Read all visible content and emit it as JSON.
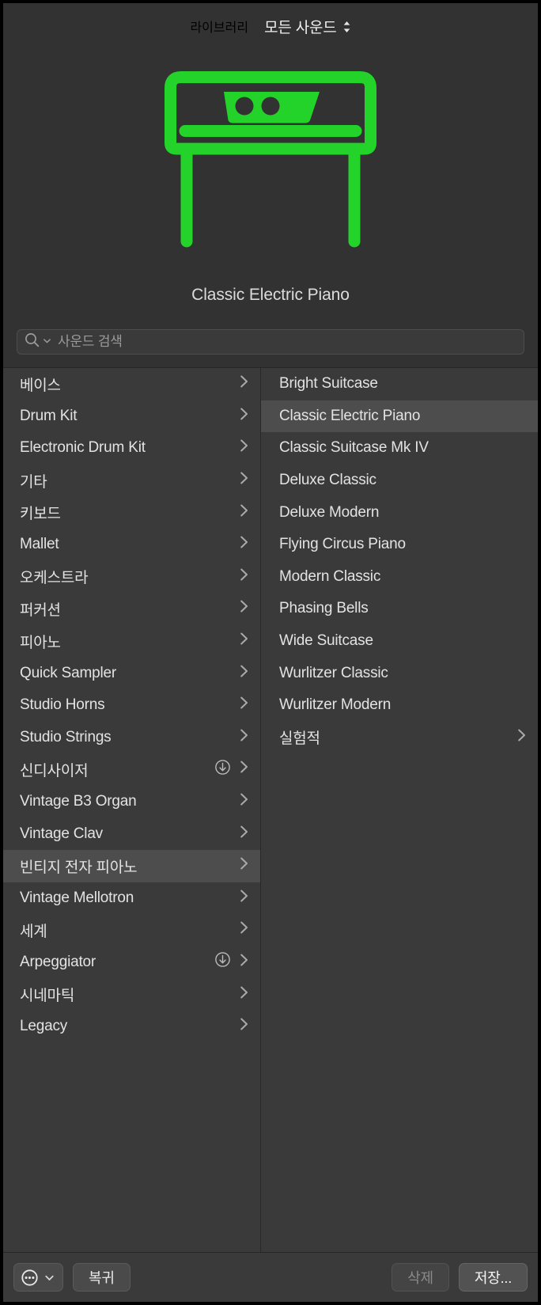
{
  "header": {
    "library_label": "라이브러리",
    "selector_label": "모든 사운드",
    "selector_icon": "chevron-up-down-icon"
  },
  "hero": {
    "icon_name": "electric-piano-icon",
    "icon_color": "#23d329"
  },
  "patch": {
    "title": "Classic Electric Piano"
  },
  "search": {
    "placeholder": "사운드 검색",
    "value": "",
    "icon": "search-icon",
    "dropdown_icon": "chevron-down-icon"
  },
  "categories": [
    {
      "label": "베이스",
      "chevron": true,
      "download": false,
      "selected": false
    },
    {
      "label": "Drum Kit",
      "chevron": true,
      "download": false,
      "selected": false
    },
    {
      "label": "Electronic Drum Kit",
      "chevron": true,
      "download": false,
      "selected": false
    },
    {
      "label": "기타",
      "chevron": true,
      "download": false,
      "selected": false
    },
    {
      "label": "키보드",
      "chevron": true,
      "download": false,
      "selected": false
    },
    {
      "label": "Mallet",
      "chevron": true,
      "download": false,
      "selected": false
    },
    {
      "label": "오케스트라",
      "chevron": true,
      "download": false,
      "selected": false
    },
    {
      "label": "퍼커션",
      "chevron": true,
      "download": false,
      "selected": false
    },
    {
      "label": "피아노",
      "chevron": true,
      "download": false,
      "selected": false
    },
    {
      "label": "Quick Sampler",
      "chevron": true,
      "download": false,
      "selected": false
    },
    {
      "label": "Studio Horns",
      "chevron": true,
      "download": false,
      "selected": false
    },
    {
      "label": "Studio Strings",
      "chevron": true,
      "download": false,
      "selected": false
    },
    {
      "label": "신디사이저",
      "chevron": true,
      "download": true,
      "selected": false
    },
    {
      "label": "Vintage B3 Organ",
      "chevron": true,
      "download": false,
      "selected": false
    },
    {
      "label": "Vintage Clav",
      "chevron": true,
      "download": false,
      "selected": false
    },
    {
      "label": "빈티지 전자 피아노",
      "chevron": true,
      "download": false,
      "selected": true
    },
    {
      "label": "Vintage Mellotron",
      "chevron": true,
      "download": false,
      "selected": false
    },
    {
      "label": "세계",
      "chevron": true,
      "download": false,
      "selected": false
    },
    {
      "label": "Arpeggiator",
      "chevron": true,
      "download": true,
      "selected": false
    },
    {
      "label": "시네마틱",
      "chevron": true,
      "download": false,
      "selected": false
    },
    {
      "label": "Legacy",
      "chevron": true,
      "download": false,
      "selected": false
    }
  ],
  "patches": [
    {
      "label": "Bright Suitcase",
      "chevron": false,
      "download": false,
      "selected": false
    },
    {
      "label": "Classic Electric Piano",
      "chevron": false,
      "download": false,
      "selected": true
    },
    {
      "label": "Classic Suitcase Mk IV",
      "chevron": false,
      "download": false,
      "selected": false
    },
    {
      "label": "Deluxe Classic",
      "chevron": false,
      "download": false,
      "selected": false
    },
    {
      "label": "Deluxe Modern",
      "chevron": false,
      "download": false,
      "selected": false
    },
    {
      "label": "Flying Circus Piano",
      "chevron": false,
      "download": false,
      "selected": false
    },
    {
      "label": "Modern Classic",
      "chevron": false,
      "download": false,
      "selected": false
    },
    {
      "label": "Phasing Bells",
      "chevron": false,
      "download": false,
      "selected": false
    },
    {
      "label": "Wide Suitcase",
      "chevron": false,
      "download": false,
      "selected": false
    },
    {
      "label": "Wurlitzer Classic",
      "chevron": false,
      "download": false,
      "selected": false
    },
    {
      "label": "Wurlitzer Modern",
      "chevron": false,
      "download": false,
      "selected": false
    },
    {
      "label": "실험적",
      "chevron": true,
      "download": false,
      "selected": false
    }
  ],
  "footer": {
    "menu_icon": "ellipsis-circle-icon",
    "menu_chevron_icon": "chevron-down-icon",
    "revert_label": "복귀",
    "delete_label": "삭제",
    "delete_disabled": true,
    "save_label": "저장..."
  }
}
